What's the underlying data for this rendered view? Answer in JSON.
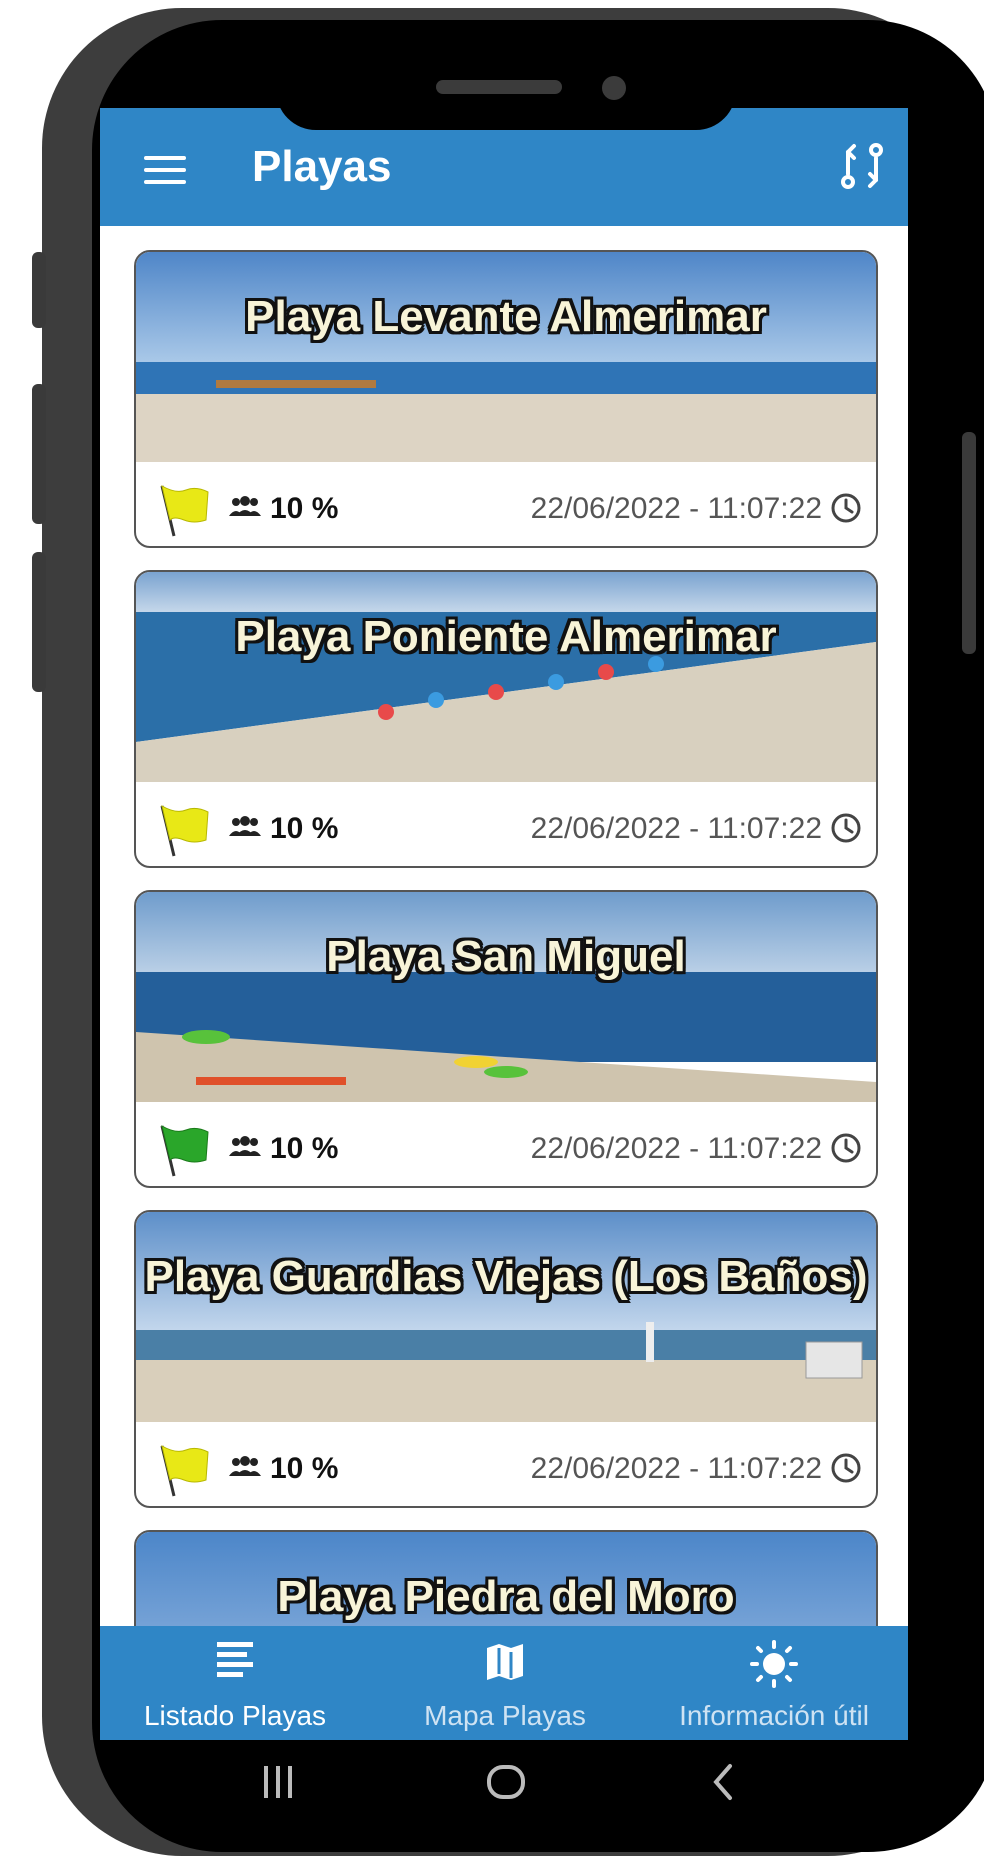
{
  "app": {
    "title": "Playas"
  },
  "colors": {
    "primary": "#2f86c6",
    "flag_yellow": "#e8e816",
    "flag_green": "#2aa62a"
  },
  "beaches": [
    {
      "name": "Playa Levante Almerimar",
      "flag": "yellow",
      "occupancy": "10 %",
      "updated": "22/06/2022 - 11:07:22"
    },
    {
      "name": "Playa Poniente Almerimar",
      "flag": "yellow",
      "occupancy": "10 %",
      "updated": "22/06/2022 - 11:07:22"
    },
    {
      "name": "Playa San Miguel",
      "flag": "green",
      "occupancy": "10 %",
      "updated": "22/06/2022 - 11:07:22"
    },
    {
      "name": "Playa Guardias Viejas (Los Baños)",
      "flag": "yellow",
      "occupancy": "10 %",
      "updated": "22/06/2022 - 11:07:22"
    },
    {
      "name": "Playa Piedra del Moro"
    }
  ],
  "bottom_nav": [
    {
      "label": "Listado Playas",
      "icon": "list-icon",
      "active": true
    },
    {
      "label": "Mapa Playas",
      "icon": "map-icon",
      "active": false
    },
    {
      "label": "Información útil",
      "icon": "sun-icon",
      "active": false
    }
  ],
  "system_nav": [
    "recents-icon",
    "home-icon",
    "back-icon"
  ]
}
